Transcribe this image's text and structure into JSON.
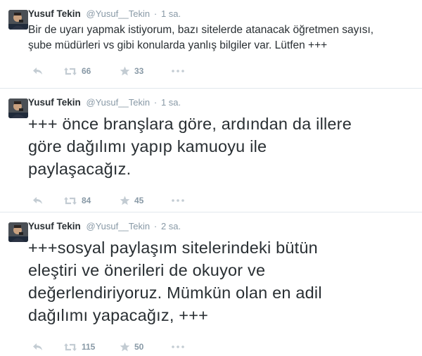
{
  "tweets": [
    {
      "fullname": "Yusuf Tekin",
      "username": "@Yusuf__Tekin",
      "separator": "·",
      "time": "1 sa.",
      "text": "Bir de uyarı yapmak istiyorum, bazı sitelerde atanacak öğretmen sayısı,\nşube müdürleri vs gibi konularda yanlış bilgiler var. Lütfen +++",
      "retweets": "66",
      "favorites": "33"
    },
    {
      "fullname": "Yusuf Tekin",
      "username": "@Yusuf__Tekin",
      "separator": "·",
      "time": "1 sa.",
      "text": "+++ önce branşlara göre, ardından da illere\ngöre dağılımı yapıp kamuoyu ile\npaylaşacağız.",
      "retweets": "84",
      "favorites": "45"
    },
    {
      "fullname": "Yusuf Tekin",
      "username": "@Yusuf__Tekin",
      "separator": "·",
      "time": "2 sa.",
      "text": "+++sosyal paylaşım sitelerindeki bütün\neleştiri ve önerileri de okuyor ve\ndeğerlendiriyoruz. Mümkün olan en adil\ndağılımı yapacağız, +++",
      "retweets": "115",
      "favorites": "50"
    }
  ],
  "colors": {
    "text": "#292f33",
    "muted": "#8899a6",
    "icon": "#c3ccd3",
    "divider": "#e1e8ed"
  },
  "icons": {
    "reply": "reply-icon",
    "retweet": "retweet-icon",
    "favorite": "star-icon",
    "more": "more-dots-icon"
  }
}
